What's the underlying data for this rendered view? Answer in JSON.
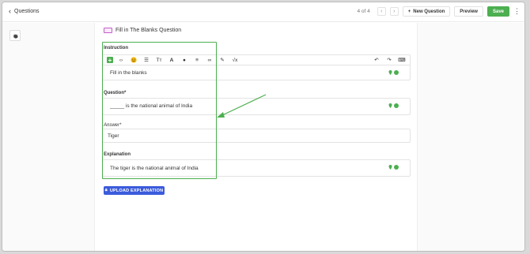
{
  "header": {
    "back_label": "Questions",
    "counter": "4 of 4",
    "prev_glyph": "‹",
    "next_glyph": "›",
    "new_question_label": "New Question",
    "preview_label": "Preview",
    "save_label": "Save"
  },
  "question_type": "Fill in The Blanks Question",
  "sections": {
    "instruction": {
      "label": "Instruction",
      "value": "Fill in the blanks"
    },
    "question": {
      "label": "Question*",
      "value": "_____ is the national animal of India"
    },
    "answer": {
      "label": "Answer*",
      "value": "Tiger"
    },
    "explanation": {
      "label": "Explanation",
      "value": "The tiger is the national animal of India"
    }
  },
  "upload_label": "UPLOAD EXPLANATION",
  "colors": {
    "accent": "#4caf50",
    "primary": "#3b5bdb"
  },
  "toolbar_icons": [
    "add-icon",
    "code-icon",
    "emoji-icon",
    "list-icon",
    "text-size-icon",
    "font-color-icon",
    "fill-color-icon",
    "align-icon",
    "link-icon",
    "brush-icon",
    "math-icon",
    "undo-icon",
    "redo-icon",
    "keyboard-icon"
  ]
}
